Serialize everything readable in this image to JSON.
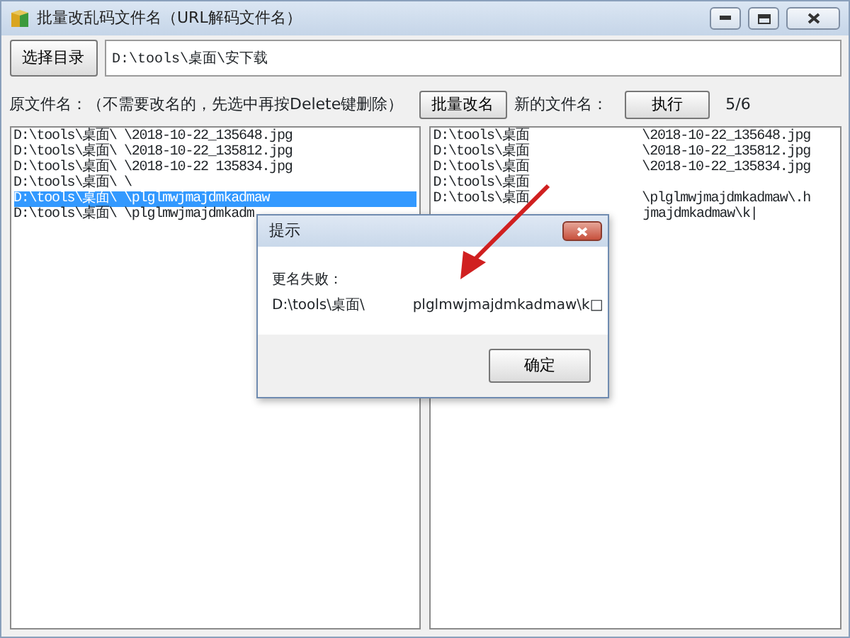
{
  "window": {
    "title": "批量改乱码文件名（URL解码文件名）"
  },
  "choose_button": "选择目录",
  "directory": "D:\\tools\\桌面\\安下载",
  "original_label": "原文件名：（不需要改名的，先选中再按Delete键删除）",
  "batch_button": "批量改名",
  "new_label": "新的文件名：",
  "run_button": "执行",
  "count": "5/6",
  "original_files": [
    {
      "path": "D:\\tools\\桌面\\",
      "name": "\\2018-10-22_135648.jpg",
      "selected": false
    },
    {
      "path": "D:\\tools\\桌面\\",
      "name": "\\2018-10-22_135812.jpg",
      "selected": false
    },
    {
      "path": "D:\\tools\\桌面\\",
      "name": "\\2018-10-22 135834.jpg",
      "selected": false
    },
    {
      "path": "D:\\tools\\桌面\\",
      "name": "\\",
      "selected": false
    },
    {
      "path": "D:\\tools\\桌面\\",
      "name": "\\plglmwjmajdmkadmaw",
      "selected": true
    },
    {
      "path": "D:\\tools\\桌面\\",
      "name": "\\plglmwjmajdmkadm",
      "selected": false
    }
  ],
  "new_files": [
    {
      "path": "D:\\tools\\桌面",
      "name": "\\2018-10-22_135648.jpg"
    },
    {
      "path": "D:\\tools\\桌面",
      "name": "\\2018-10-22_135812.jpg"
    },
    {
      "path": "D:\\tools\\桌面",
      "name": "\\2018-10-22_135834.jpg"
    },
    {
      "path": "D:\\tools\\桌面"
    },
    {
      "path": "D:\\tools\\桌面",
      "name": "\\plglmwjmajdmkadmaw\\.h"
    },
    {
      "name": "jmajdmkadmaw\\k|"
    }
  ],
  "dialog": {
    "title": "提示",
    "message": "更名失败：",
    "path": "D:\\tools\\桌面\\",
    "name": "plglmwjmajdmkadmaw\\k□",
    "ok_button": "确定"
  }
}
